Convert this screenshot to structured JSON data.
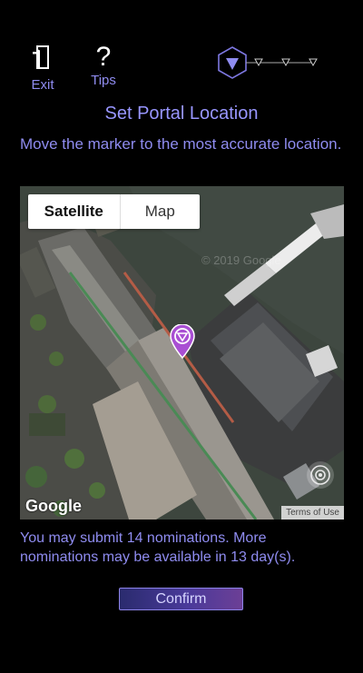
{
  "header": {
    "exit_label": "Exit",
    "tips_label": "Tips",
    "tips_glyph": "?",
    "step_count": 4,
    "current_step": 1
  },
  "title": "Set Portal Location",
  "instructions": "Move the marker to the most accurate location.",
  "map": {
    "type_buttons": {
      "satellite": "Satellite",
      "map": "Map"
    },
    "selected_type": "Satellite",
    "watermark": "© 2019 Google",
    "logo": "Google",
    "terms": "Terms of Use"
  },
  "note": "You may submit 14 nominations. More nominations may be available in 13 day(s).",
  "confirm_label": "Confirm",
  "colors": {
    "accent": "#8f8cf0",
    "marker": "#a94fd3",
    "background": "#000000"
  }
}
